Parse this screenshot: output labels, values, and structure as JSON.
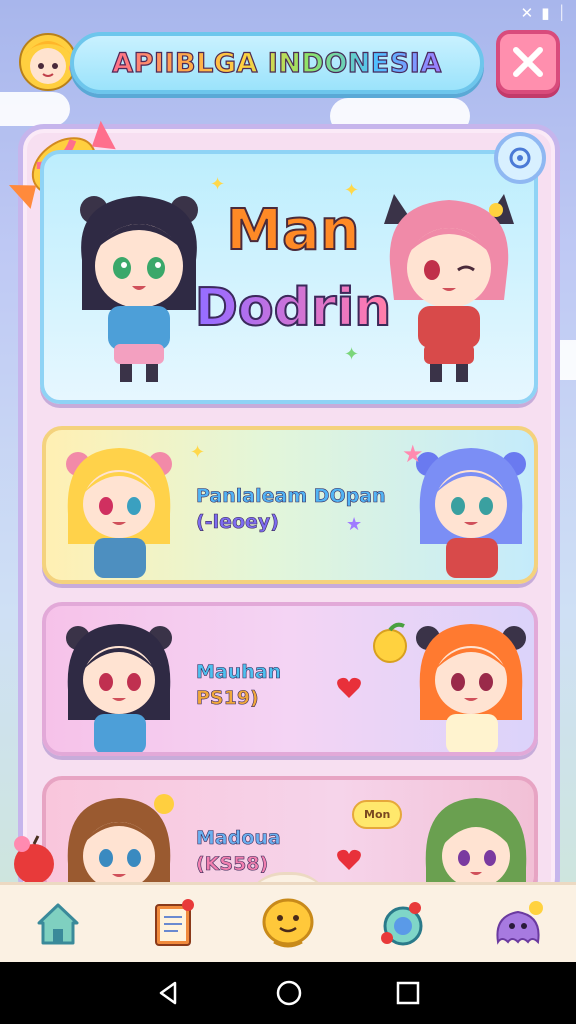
{
  "header": {
    "title": "APIIBLGA INDONESIA",
    "close_icon": "close-icon",
    "avatar_icon": "avatar-icon"
  },
  "hero_card": {
    "line1": "Man",
    "line2": "Dodrin"
  },
  "cards": [
    {
      "title": "Panlaleam DOpan",
      "subtitle": "(-leoey)"
    },
    {
      "title": "Mauhan",
      "subtitle": "PS19)"
    },
    {
      "title": "Madoua",
      "subtitle": "(KS58)"
    }
  ],
  "speech_bubble": "Mon",
  "bottom_nav": [
    {
      "icon": "home-icon"
    },
    {
      "icon": "book-icon"
    },
    {
      "icon": "mascot-icon"
    },
    {
      "icon": "gamepad-icon"
    },
    {
      "icon": "monster-icon"
    }
  ],
  "system_nav": [
    "back-icon",
    "home-circle-icon",
    "recents-icon"
  ],
  "colors": {
    "accent_blue": "#6dc6ec",
    "close_pink": "#ff8fae",
    "panel_bg": "#f7dff1",
    "nav_bg": "#fbf1e3"
  }
}
